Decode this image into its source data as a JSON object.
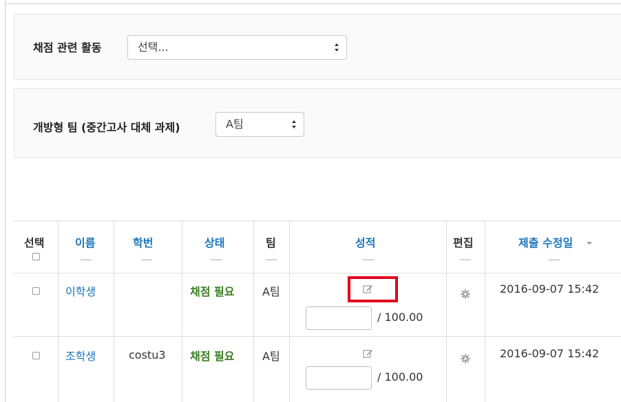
{
  "filters": {
    "grading_activity": {
      "label": "채점 관련 활동",
      "value": "선택..."
    },
    "group": {
      "label": "개방형 팀 (중간고사 대체 과제)",
      "value": "A팀"
    }
  },
  "table": {
    "columns": {
      "select": "선택",
      "name": "이름",
      "student_id": "학번",
      "status": "상태",
      "team": "팀",
      "grade": "성적",
      "edit": "편집",
      "modified": "제출 수정일"
    },
    "rows": [
      {
        "name": "이학생",
        "student_id": "",
        "status": "채점 필요",
        "team": "A팀",
        "grade_value": "",
        "grade_max": "/ 100.00",
        "modified": "2016-09-07 15:42"
      },
      {
        "name": "조학생",
        "student_id": "costu3",
        "status": "채점 필요",
        "team": "A팀",
        "grade_value": "",
        "grade_max": "/ 100.00",
        "modified": "2016-09-07 15:42"
      }
    ]
  },
  "icons": {
    "grade_edit": "pencil-edit-icon",
    "row_edit": "gear-icon",
    "sort": "caret-down-icon"
  },
  "colors": {
    "link": "#1b75bb",
    "status": "#3a7d21",
    "highlight": "#e0001b"
  }
}
